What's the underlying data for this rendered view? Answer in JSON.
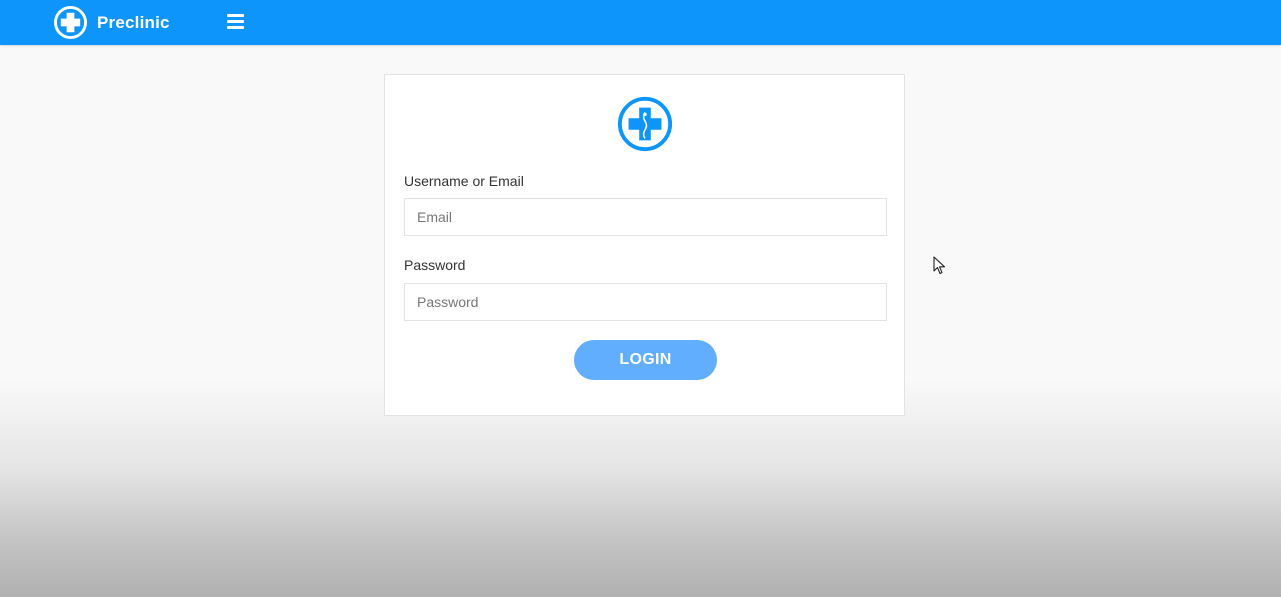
{
  "header": {
    "brand_name": "Preclinic",
    "brand_icon": "medical-cross-icon",
    "menu_icon": "hamburger-menu-icon",
    "background_color": "#0d95fc"
  },
  "login": {
    "logo_icon": "medical-cross-icon",
    "username_label": "Username or Email",
    "username_placeholder": "Email",
    "password_label": "Password",
    "password_placeholder": "Password",
    "login_button": "LOGIN",
    "button_color": "#61aefe"
  },
  "cursor": {
    "icon": "mouse-pointer-icon"
  }
}
